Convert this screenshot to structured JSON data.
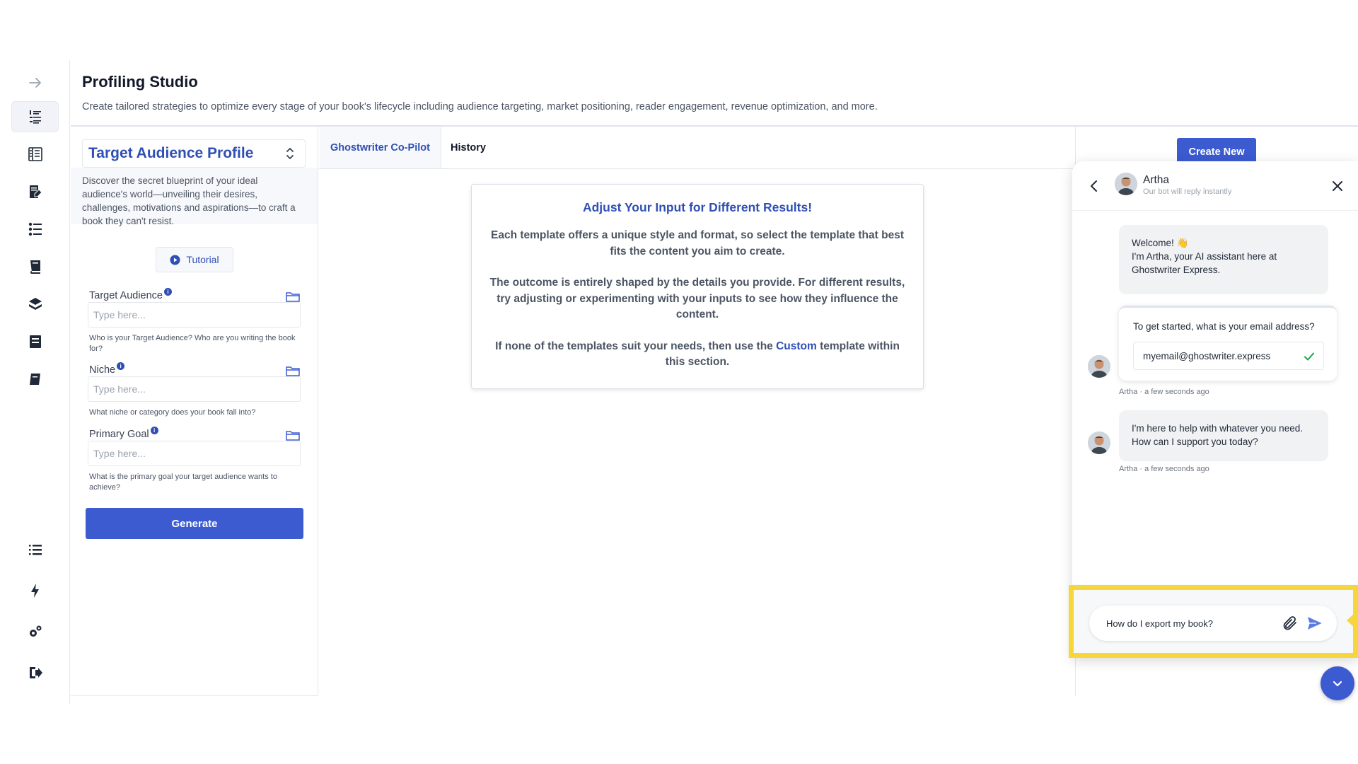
{
  "rail": {
    "icons": [
      "arrow-right-icon",
      "list-numbered-icon",
      "book-layout-icon",
      "notebook-edit-icon",
      "checklist-icon",
      "book-icon",
      "book-stack-icon",
      "archive-icon",
      "book-small-icon",
      "list-icon",
      "lightning-icon",
      "settings-gears-icon",
      "logout-icon"
    ]
  },
  "header": {
    "title": "Profiling Studio",
    "subtitle": "Create tailored strategies to optimize every stage of your book's lifecycle including audience targeting, market positioning, reader engagement, revenue optimization, and more."
  },
  "form": {
    "profile_select": "Target Audience Profile",
    "profile_description": "Discover the secret blueprint of your ideal audience's world—unveiling their desires, challenges, motivations and aspirations—to craft a book they can't resist.",
    "tutorial_label": "Tutorial",
    "info_glyph": "i",
    "fields": [
      {
        "label": "Target Audience",
        "placeholder": "Type here...",
        "help": "Who is your Target Audience? Who are you writing the book for?"
      },
      {
        "label": "Niche",
        "placeholder": "Type here...",
        "help": "What niche or category does your book fall into?"
      },
      {
        "label": "Primary Goal",
        "placeholder": "Type here...",
        "help": "What is the primary goal your target audience wants to achieve?"
      }
    ],
    "generate_label": "Generate"
  },
  "tabs": [
    {
      "label": "Ghostwriter Co-Pilot",
      "active": true
    },
    {
      "label": "History",
      "active": false
    }
  ],
  "notice": {
    "title": "Adjust Your Input for Different Results!",
    "p1": "Each template offers a unique style and format, so select the template that best fits the content you aim to create.",
    "p2": "The outcome is entirely shaped by the details you provide. For different results, try adjusting or experimenting with your inputs to see how they influence the content.",
    "p3_before": "If none of the templates suit your needs, then use the ",
    "p3_link": "Custom",
    "p3_after": " template within this section."
  },
  "create_new_label": "Create New",
  "chat": {
    "name": "Artha",
    "status": "Our bot will reply instantly",
    "welcome_line1": "Welcome! 👋",
    "welcome_line2": "I'm Artha, your AI assistant here at Ghostwriter Express.",
    "email_question": "To get started, what is your email address?",
    "email_value": "myemail@ghostwriter.express",
    "meta1": "Artha · a few seconds ago",
    "help_message": "I'm here to help with whatever you need. How can I support you today?",
    "meta2": "Artha · a few seconds ago",
    "composer_value": "How do I export my book?"
  },
  "colors": {
    "accent": "#3c5bd1",
    "highlight": "#f5d73c",
    "success": "#16a34a"
  }
}
